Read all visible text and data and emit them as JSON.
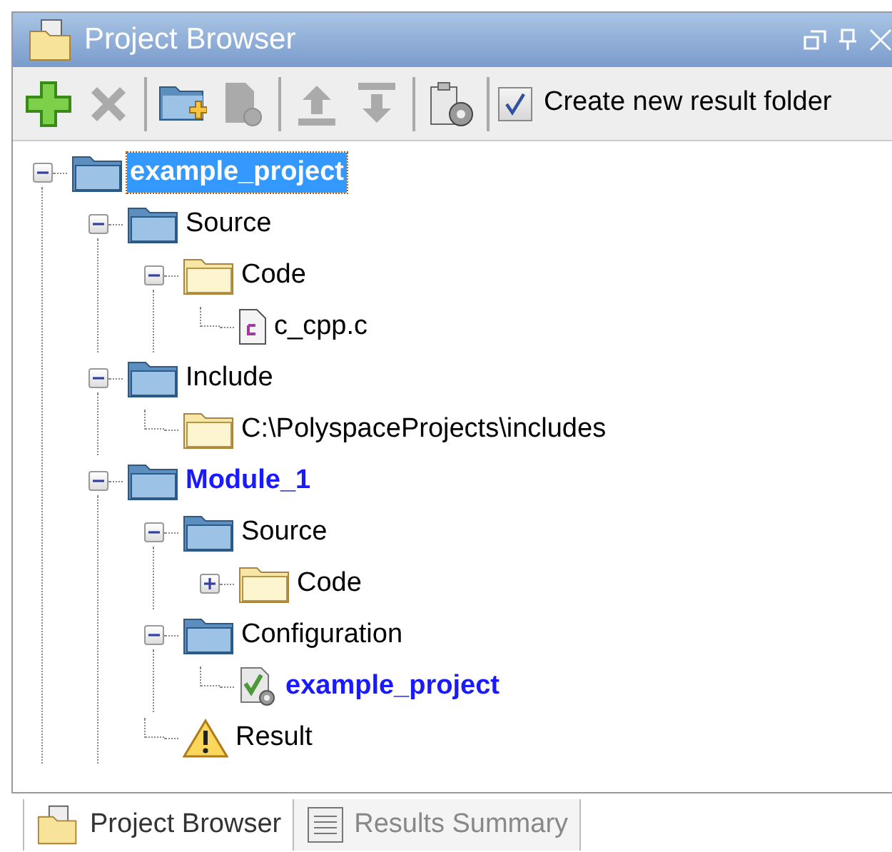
{
  "window": {
    "title": "Project Browser"
  },
  "toolbar": {
    "buttons": [
      {
        "kind": "add",
        "disabled": false
      },
      {
        "kind": "delete",
        "disabled": true
      },
      {
        "kind": "addfolder",
        "disabled": false
      },
      {
        "kind": "config",
        "disabled": true
      },
      {
        "kind": "up",
        "disabled": true
      },
      {
        "kind": "down",
        "disabled": true
      },
      {
        "kind": "settings",
        "disabled": false
      }
    ],
    "checkbox": {
      "label": "Create new result folder",
      "checked": true
    }
  },
  "tree": [
    {
      "label": "example_project",
      "kind": "project",
      "bold": true,
      "selected": true,
      "expanded": true,
      "children": [
        {
          "label": "Source",
          "kind": "project",
          "bold": false,
          "selected": false,
          "expanded": true,
          "children": [
            {
              "label": "Code",
              "kind": "folder",
              "bold": false,
              "selected": false,
              "expanded": true,
              "children": [
                {
                  "label": "c_cpp.c",
                  "kind": "file",
                  "bold": false,
                  "selected": false
                }
              ]
            }
          ]
        },
        {
          "label": "Include",
          "kind": "project",
          "bold": false,
          "selected": false,
          "expanded": true,
          "children": [
            {
              "label": "C:\\PolyspaceProjects\\includes",
              "kind": "folder",
              "bold": false,
              "selected": false
            }
          ]
        },
        {
          "label": "Module_1",
          "kind": "project",
          "bold": true,
          "selected": false,
          "expanded": true,
          "children": [
            {
              "label": "Source",
              "kind": "project",
              "bold": false,
              "selected": false,
              "expanded": true,
              "children": [
                {
                  "label": "Code",
                  "kind": "folder",
                  "bold": false,
                  "selected": false,
                  "expanded": false
                }
              ]
            },
            {
              "label": "Configuration",
              "kind": "project",
              "bold": false,
              "selected": false,
              "expanded": true,
              "children": [
                {
                  "label": "example_project",
                  "kind": "config",
                  "bold": true,
                  "selected": false
                }
              ]
            },
            {
              "label": "Result",
              "kind": "warning",
              "bold": false,
              "selected": false
            }
          ]
        }
      ]
    }
  ],
  "bottom_tabs": [
    {
      "label": "Project Browser",
      "kind": "browser",
      "selected": true
    },
    {
      "label": "Results Summary",
      "kind": "summary",
      "selected": false
    }
  ]
}
